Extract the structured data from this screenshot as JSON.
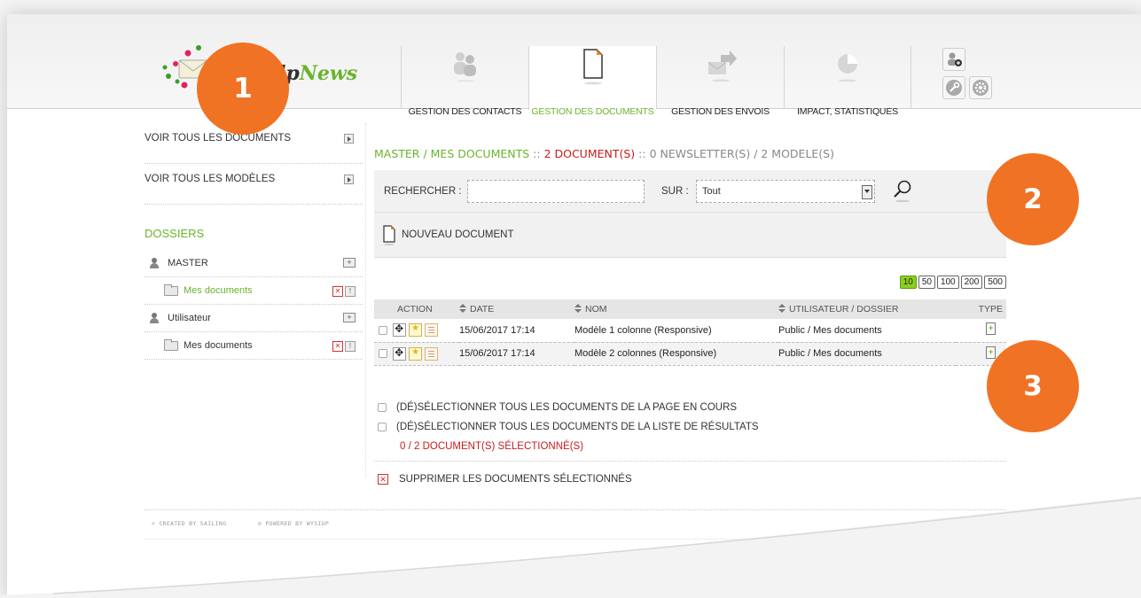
{
  "brand": {
    "logo_prefix": "lp",
    "logo_suffix": "News",
    "accent": "#6ab42c",
    "badge_color": "#f07020"
  },
  "nav": {
    "tabs": [
      {
        "label": "GESTION DES CONTACTS",
        "icon": "contacts-icon"
      },
      {
        "label": "GESTION DES DOCUMENTS",
        "icon": "document-icon"
      },
      {
        "label": "GESTION DES ENVOIS",
        "icon": "send-icon"
      },
      {
        "label": "IMPACT, STATISTIQUES",
        "icon": "pie-chart-icon"
      }
    ],
    "active": "GESTION DES DOCUMENTS"
  },
  "sidebar": {
    "links": [
      "VOIR TOUS LES DOCUMENTS",
      "VOIR TOUS LES MODÈLES"
    ],
    "folders_title": "DOSSIERS",
    "groups": [
      {
        "user": "MASTER",
        "folder": "Mes documents"
      },
      {
        "user": "Utilisateur",
        "folder": "Mes documents"
      }
    ]
  },
  "breadcrumb": {
    "path": "MASTER / MES DOCUMENTS",
    "sep1": " :: ",
    "documents": "2 DOCUMENT(S)",
    "sep2": " :: ",
    "rest": "0 NEWSLETTER(S) / 2 MODELE(S)"
  },
  "search": {
    "label": "RECHERCHER :",
    "value": "",
    "on_label": "SUR :",
    "on_value": "Tout"
  },
  "new_document": "NOUVEAU DOCUMENT",
  "pager": {
    "sizes": [
      "10",
      "50",
      "100",
      "200",
      "500"
    ],
    "selected": "10"
  },
  "table": {
    "headers": {
      "action": "ACTION",
      "date": "DATE",
      "name": "NOM",
      "user_folder": "UTILISATEUR / DOSSIER",
      "type": "TYPE"
    },
    "rows": [
      {
        "date": "15/06/2017 17:14",
        "name": "Modèle 1 colonne (Responsive)",
        "user_folder": "Public / Mes documents"
      },
      {
        "date": "15/06/2017 17:14",
        "name": "Modèle 2 colonnes (Responsive)",
        "user_folder": "Public / Mes documents"
      }
    ]
  },
  "selection": {
    "page": "(DÉ)SÉLECTIONNER TOUS LES DOCUMENTS DE LA PAGE EN COURS",
    "list": "(DÉ)SÉLECTIONNER TOUS LES DOCUMENTS DE LA LISTE DE RÉSULTATS",
    "count": "0 / 2 DOCUMENT(S) SÉLECTIONNÉ(S)"
  },
  "delete_selected": "SUPPRIMER LES DOCUMENTS SÉLECTIONNÉS",
  "footer": {
    "created": "CREATED BY SAILING",
    "powered": "POWERED BY WYSIUP"
  },
  "badges": [
    "1",
    "2",
    "3"
  ]
}
